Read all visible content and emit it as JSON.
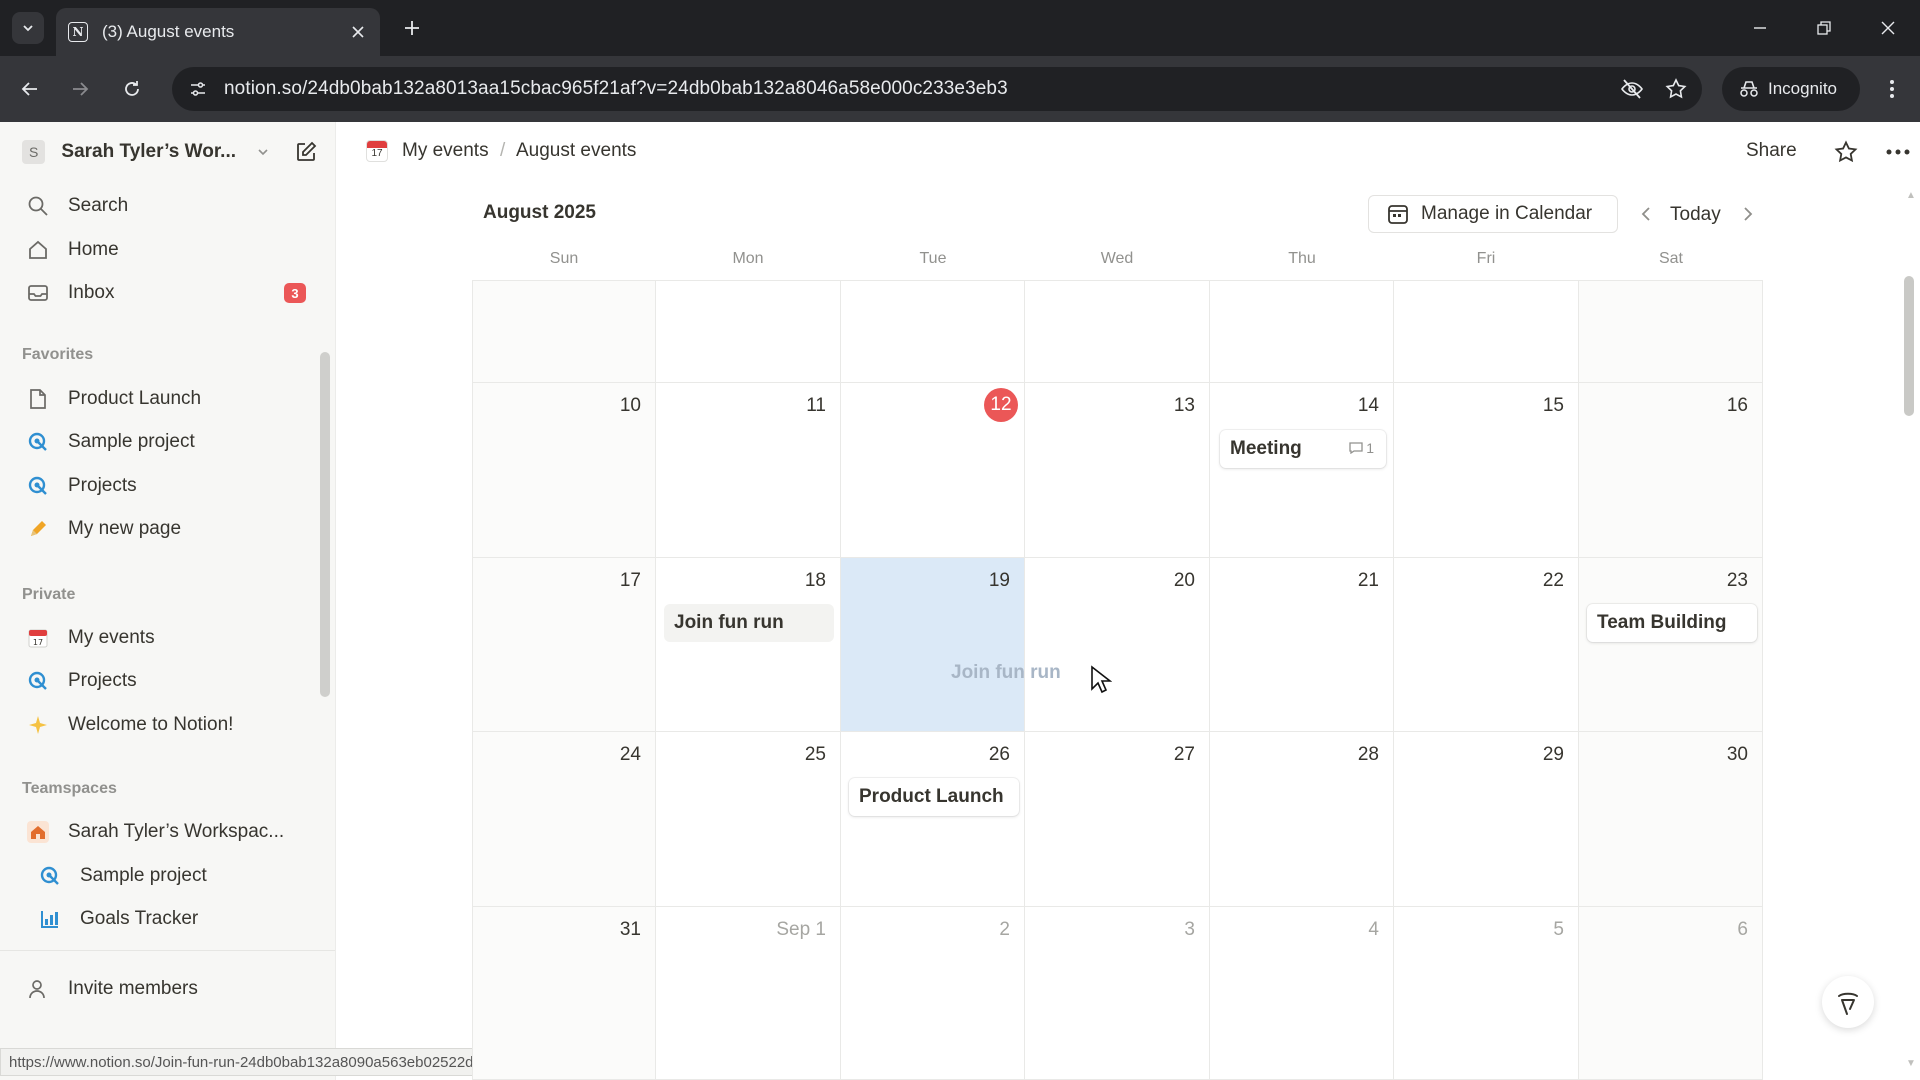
{
  "browser": {
    "tab_title": "(3) August events",
    "tab_favicon": "N",
    "url": "notion.so/24db0bab132a8013aa15cbac965f21af?v=24db0bab132a8046a58e000c233e3eb3",
    "incognito_label": "Incognito",
    "status_url": "https://www.notion.so/Join-fun-run-24db0bab132a8090a563eb02522d6020?pvs=..."
  },
  "sidebar": {
    "workspace_initial": "S",
    "workspace_name": "Sarah Tyler’s Wor...",
    "nav": [
      {
        "label": "Search",
        "icon": "search-icon"
      },
      {
        "label": "Home",
        "icon": "home-icon"
      },
      {
        "label": "Inbox",
        "icon": "inbox-icon",
        "badge": "3"
      }
    ],
    "favorites_heading": "Favorites",
    "favorites": [
      {
        "label": "Product Launch",
        "icon": "page-icon"
      },
      {
        "label": "Sample project",
        "icon": "project-icon"
      },
      {
        "label": "Projects",
        "icon": "project-icon"
      },
      {
        "label": "My new page",
        "icon": "pencil-icon"
      }
    ],
    "private_heading": "Private",
    "private": [
      {
        "label": "My events",
        "icon": "calendar-icon"
      },
      {
        "label": "Projects",
        "icon": "project-icon"
      },
      {
        "label": "Welcome to Notion!",
        "icon": "sparkle-icon"
      }
    ],
    "teamspaces_heading": "Teamspaces",
    "teamspaces": [
      {
        "label": "Sarah Tyler’s Workspac...",
        "icon": "house-icon"
      },
      {
        "label": "Sample project",
        "icon": "project-icon"
      },
      {
        "label": "Goals Tracker",
        "icon": "chart-icon"
      }
    ],
    "invite_label": "Invite members"
  },
  "topbar": {
    "breadcrumb": [
      "My events",
      "August events"
    ],
    "calendar_emoji_day": "17",
    "share_label": "Share"
  },
  "calendar": {
    "month_title": "August 2025",
    "manage_label": "Manage in Calendar",
    "today_label": "Today",
    "weekdays": [
      "Sun",
      "Mon",
      "Tue",
      "Wed",
      "Thu",
      "Fri",
      "Sat"
    ],
    "today_date": "12",
    "weeks": [
      [
        "",
        "",
        "",
        "",
        "",
        "",
        ""
      ],
      [
        "10",
        "11",
        "12",
        "13",
        "14",
        "15",
        "16"
      ],
      [
        "17",
        "18",
        "19",
        "20",
        "21",
        "22",
        "23"
      ],
      [
        "24",
        "25",
        "26",
        "27",
        "28",
        "29",
        "30"
      ],
      [
        "31",
        "Sep 1",
        "2",
        "3",
        "4",
        "5",
        "6"
      ]
    ],
    "events": {
      "meeting": {
        "title": "Meeting",
        "comments": "1"
      },
      "fun_run": {
        "title": "Join fun run"
      },
      "team_building": {
        "title": "Team Building"
      },
      "product_launch": {
        "title": "Product Launch"
      },
      "drag_ghost": {
        "title": "Join fun run"
      }
    }
  },
  "colors": {
    "accent_red": "#eb5757",
    "drop_highlight": "#dbe9f7",
    "text": "#37352f"
  }
}
